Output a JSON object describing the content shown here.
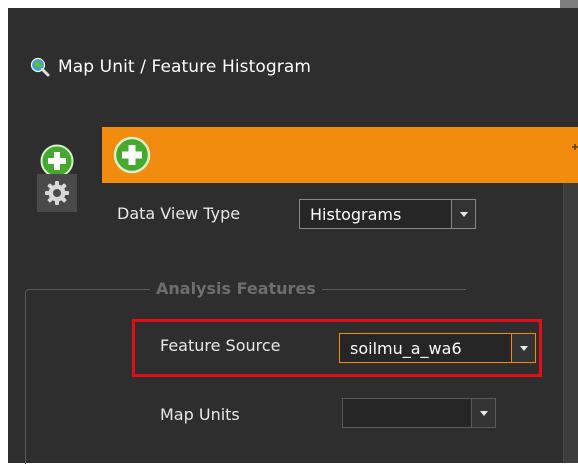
{
  "window": {
    "title": "Map Unit / Feature Histogram",
    "title_icon": "map-search-icon"
  },
  "sidebar": {
    "add_icon": "add-icon",
    "settings_icon": "gear-icon"
  },
  "panel": {
    "header_color": "#f28c0e",
    "add_icon": "add-icon",
    "data_view_type": {
      "label": "Data View Type",
      "value": "Histograms"
    },
    "analysis_features": {
      "legend": "Analysis Features",
      "feature_source": {
        "label": "Feature Source",
        "value": "soilmu_a_wa6",
        "highlight_color": "#e0101a"
      },
      "map_units": {
        "label": "Map Units",
        "value": ""
      }
    }
  }
}
